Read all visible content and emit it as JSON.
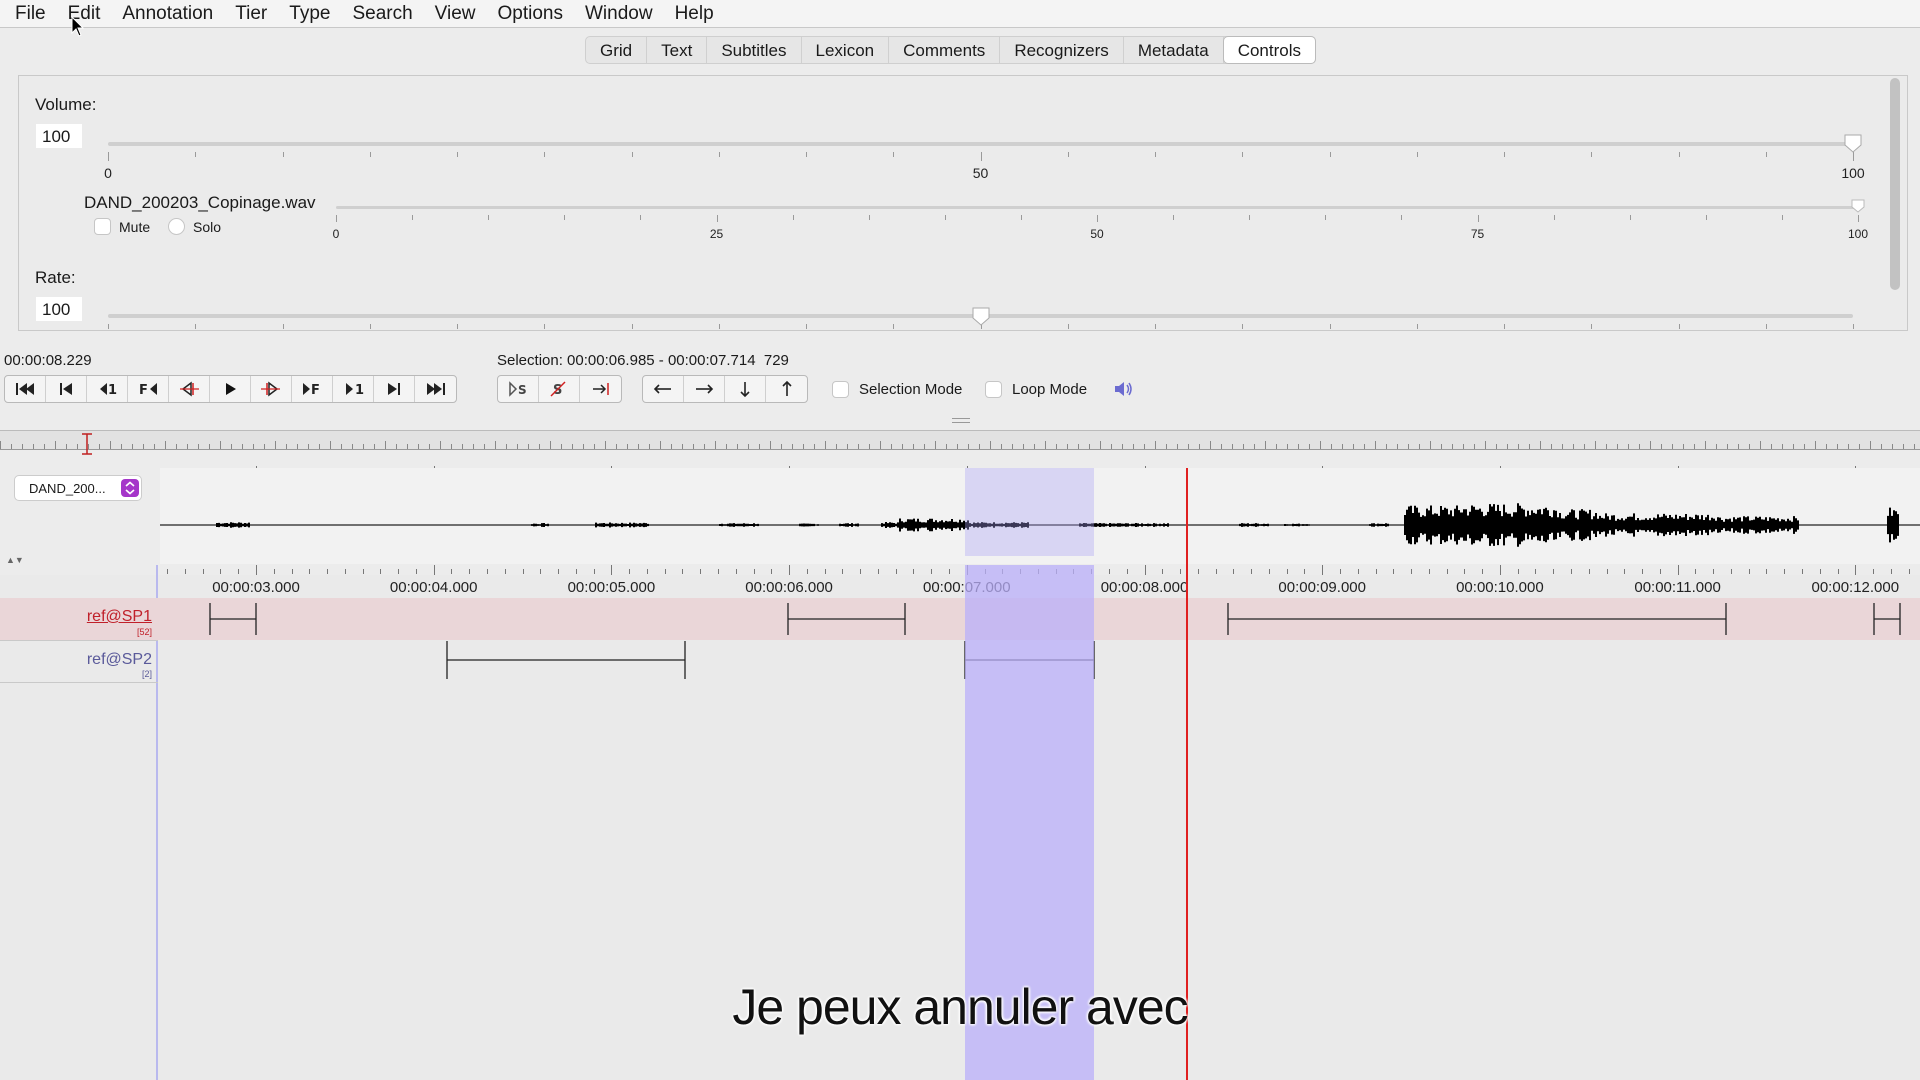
{
  "menu": [
    "File",
    "Edit",
    "Annotation",
    "Tier",
    "Type",
    "Search",
    "View",
    "Options",
    "Window",
    "Help"
  ],
  "tabs": [
    {
      "label": "Grid",
      "active": false
    },
    {
      "label": "Text",
      "active": false
    },
    {
      "label": "Subtitles",
      "active": false
    },
    {
      "label": "Lexicon",
      "active": false
    },
    {
      "label": "Comments",
      "active": false
    },
    {
      "label": "Recognizers",
      "active": false
    },
    {
      "label": "Metadata",
      "active": false
    },
    {
      "label": "Controls",
      "active": true
    }
  ],
  "controls": {
    "volume_label": "Volume:",
    "volume_value": "100",
    "volume_ticks": [
      "0",
      "50",
      "100"
    ],
    "file_name": "DAND_200203_Copinage.wav",
    "mute_label": "Mute",
    "solo_label": "Solo",
    "file_ticks": [
      "0",
      "25",
      "50",
      "75",
      "100"
    ],
    "file_volume": 100,
    "rate_label": "Rate:",
    "rate_value": "100",
    "rate_fraction": 0.5
  },
  "transport": {
    "current_time": "00:00:08.229",
    "selection": "Selection: 00:00:06.985 - 00:00:07.714  729",
    "selection_mode_label": "Selection Mode",
    "loop_mode_label": "Loop Mode",
    "buttons": [
      {
        "name": "go-to-begin-button",
        "icon": "begin-icon"
      },
      {
        "name": "previous-frame-start-button",
        "icon": "prev-icon"
      },
      {
        "name": "step-back-second-button",
        "icon": "step-back-1-icon",
        "text": "1"
      },
      {
        "name": "previous-frame-button",
        "icon": "frame-back-icon",
        "text": "F"
      },
      {
        "name": "previous-pixel-button",
        "icon": "pixel-back-icon"
      },
      {
        "name": "play-button",
        "icon": "play-icon"
      },
      {
        "name": "next-pixel-button",
        "icon": "pixel-forward-icon"
      },
      {
        "name": "next-frame-button",
        "icon": "frame-forward-icon",
        "text": "F"
      },
      {
        "name": "step-forward-second-button",
        "icon": "step-forward-1-icon",
        "text": "1"
      },
      {
        "name": "next-frame-end-button",
        "icon": "next-icon"
      },
      {
        "name": "go-to-end-button",
        "icon": "end-icon"
      }
    ]
  },
  "media_selector": {
    "label": "DAND_200..."
  },
  "ruler_times": [
    "00:00:03.000",
    "00:00:04.000",
    "00:00:05.000",
    "00:00:06.000",
    "00:00:07.000",
    "00:00:08.000",
    "00:00:09.000",
    "00:00:10.000",
    "00:00:11.000",
    "00:00:12.000"
  ],
  "tiers": [
    {
      "name": "ref@SP1",
      "count": "[52]",
      "color": "#c0202a"
    },
    {
      "name": "ref@SP2",
      "count": "[2]",
      "color": "#5a5a9a"
    }
  ],
  "colors": {
    "selection": "#c7c2f7",
    "crosshair": "#e02020",
    "tier_active_bg": "#ead6d8"
  },
  "subtitle": "Je peux annuler avec"
}
